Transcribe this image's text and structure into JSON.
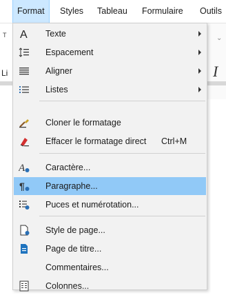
{
  "menubar": {
    "items": [
      "Format",
      "Styles",
      "Tableau",
      "Formulaire",
      "Outils"
    ]
  },
  "background": {
    "frag_top": "T",
    "frag_li": "Li",
    "frag_italic": "I"
  },
  "menu": {
    "items": [
      {
        "label": "Texte",
        "icon": "text-a-icon",
        "submenu": true
      },
      {
        "label": "Espacement",
        "icon": "spacing-icon",
        "submenu": true
      },
      {
        "label": "Aligner",
        "icon": "align-icon",
        "submenu": true
      },
      {
        "label": "Listes",
        "icon": "list-icon",
        "submenu": true
      },
      {
        "label": "Cloner le formatage",
        "icon": "clone-brush-icon"
      },
      {
        "label": "Effacer le formatage direct",
        "shortcut": "Ctrl+M",
        "icon": "clear-format-icon"
      },
      {
        "label": "Caractère...",
        "icon": "character-icon"
      },
      {
        "label": "Paragraphe...",
        "icon": "paragraph-icon",
        "highlighted": true
      },
      {
        "label": "Puces et numérotation...",
        "icon": "bullets-icon"
      },
      {
        "label": "Style de page...",
        "icon": "page-style-icon"
      },
      {
        "label": "Page de titre...",
        "icon": "title-page-icon"
      },
      {
        "label": "Commentaires..."
      },
      {
        "label": "Colonnes...",
        "icon": "columns-icon"
      }
    ]
  },
  "colors": {
    "highlight": "#91c9f7",
    "menubar_active": "#cce8ff",
    "menu_bg": "#f2f2f2"
  }
}
